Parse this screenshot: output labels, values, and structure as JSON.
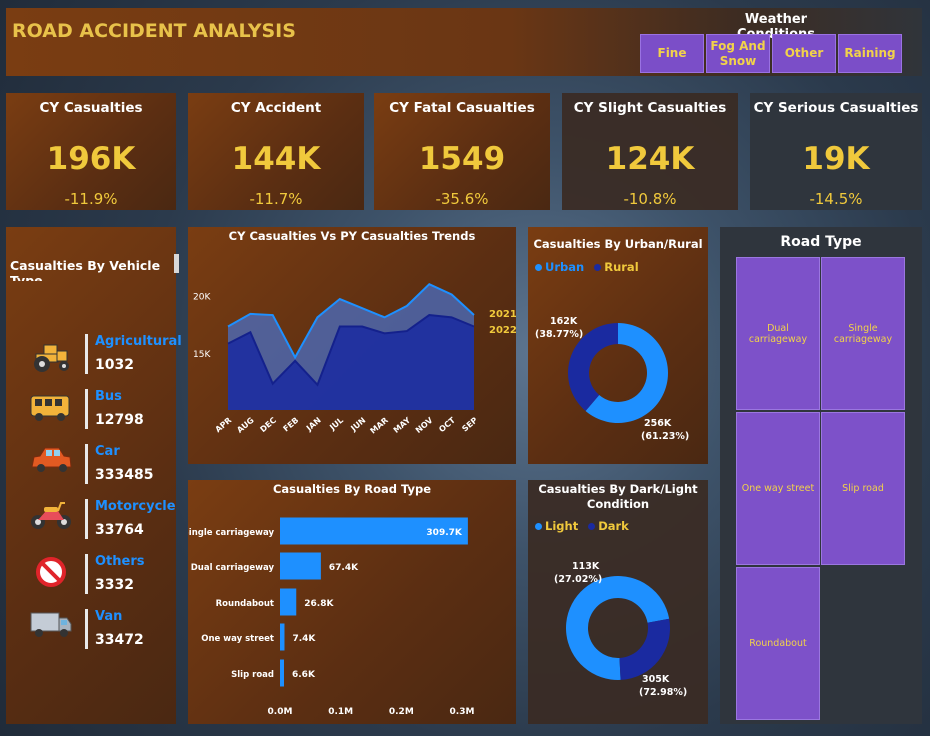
{
  "header": {
    "title": "ROAD ACCIDENT ANALYSIS"
  },
  "weather": {
    "title": "Weather Conditions",
    "buttons": [
      "Fine",
      "Fog And Snow",
      "Other",
      "Raining"
    ]
  },
  "kpis": [
    {
      "label": "CY Casualties",
      "value": "196K",
      "change": "-11.9%"
    },
    {
      "label": "CY Accident",
      "value": "144K",
      "change": "-11.7%"
    },
    {
      "label": "CY Fatal Casualties",
      "value": "1549",
      "change": "-35.6%"
    },
    {
      "label": "CY Slight Casualties",
      "value": "124K",
      "change": "-10.8%"
    },
    {
      "label": "CY Serious Casualties",
      "value": "19K",
      "change": "-14.5%"
    }
  ],
  "vehicles": {
    "title": "Casualties By Vehicle",
    "title_cut": "Type",
    "items": [
      {
        "name": "Agricultural",
        "value": "1032",
        "icon": "tractor-icon"
      },
      {
        "name": "Bus",
        "value": "12798",
        "icon": "bus-icon"
      },
      {
        "name": "Car",
        "value": "333485",
        "icon": "car-icon"
      },
      {
        "name": "Motorcycle",
        "value": "33764",
        "icon": "motorcycle-icon"
      },
      {
        "name": "Others",
        "value": "3332",
        "icon": "no-entry-icon"
      },
      {
        "name": "Van",
        "value": "33472",
        "icon": "van-icon"
      }
    ]
  },
  "colors": {
    "accent_yellow": "#f0c93c",
    "blue": "#1e90ff",
    "dark_blue": "#1a2aa0",
    "purple": "#7d51c9"
  },
  "road_type_panel": {
    "title": "Road Type",
    "tiles": [
      "Dual carriageway",
      "Single carriageway",
      "One way street",
      "Slip road",
      "Roundabout"
    ]
  },
  "chart_data": [
    {
      "type": "area",
      "title": "CY Casualties Vs PY Casualties Trends",
      "x": [
        "APR",
        "AUG",
        "DEC",
        "FEB",
        "JAN",
        "JUL",
        "JUN",
        "MAR",
        "MAY",
        "NOV",
        "OCT",
        "SEP"
      ],
      "yticks": [
        "20K",
        "15K"
      ],
      "ylim": [
        10000,
        22500
      ],
      "series": [
        {
          "name": "2021",
          "values": [
            17300,
            18400,
            18300,
            14600,
            18100,
            19700,
            18900,
            18100,
            19100,
            21000,
            20100,
            18300
          ]
        },
        {
          "name": "2022",
          "values": [
            15800,
            16800,
            12300,
            14300,
            12200,
            17300,
            17300,
            16700,
            16900,
            18300,
            18100,
            17300
          ]
        }
      ]
    },
    {
      "type": "pie",
      "title": "Casualties By Urban/Rural",
      "legend": [
        "Urban",
        "Rural"
      ],
      "slices": [
        {
          "name": "Urban",
          "value": 256,
          "label": "256K",
          "pct": "(61.23%)"
        },
        {
          "name": "Rural",
          "value": 162,
          "label": "162K",
          "pct": "(38.77%)"
        }
      ]
    },
    {
      "type": "bar",
      "title": "Casualties By Road Type",
      "categories": [
        "Single carriageway",
        "Dual carriageway",
        "Roundabout",
        "One way street",
        "Slip road"
      ],
      "values": [
        309.7,
        67.4,
        26.8,
        7.4,
        6.6
      ],
      "labels": [
        "309.7K",
        "67.4K",
        "26.8K",
        "7.4K",
        "6.6K"
      ],
      "xticks": [
        "0.0M",
        "0.1M",
        "0.2M",
        "0.3M"
      ],
      "xlim": [
        0,
        300
      ]
    },
    {
      "type": "pie",
      "title": "Casualties By Dark/Light Condition",
      "legend": [
        "Light",
        "Dark"
      ],
      "slices": [
        {
          "name": "Light",
          "value": 305,
          "label": "305K",
          "pct": "(72.98%)"
        },
        {
          "name": "Dark",
          "value": 113,
          "label": "113K",
          "pct": "(27.02%)"
        }
      ]
    }
  ]
}
